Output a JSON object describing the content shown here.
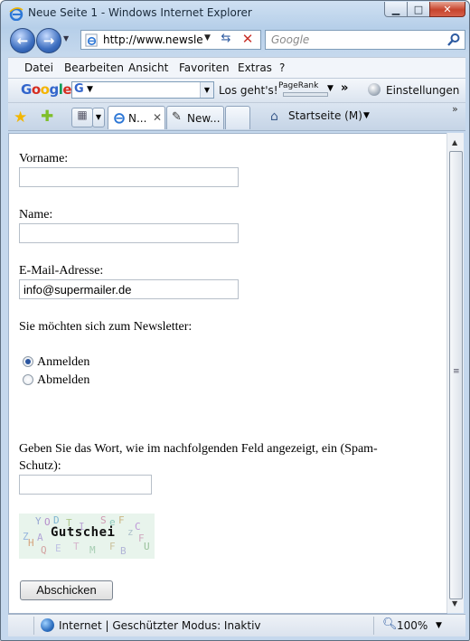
{
  "window": {
    "title": "Neue Seite 1 - Windows Internet Explorer",
    "minimize": "▁",
    "maximize": "□",
    "close": "✕"
  },
  "nav": {
    "address": "http://www.newsle",
    "search_placeholder": "Google"
  },
  "menu": [
    "Datei",
    "Bearbeiten",
    "Ansicht",
    "Favoriten",
    "Extras",
    "?"
  ],
  "google_toolbar": {
    "logo": "Google",
    "combo_letter": "G",
    "go": "Los geht's!",
    "pagerank": "PageRank",
    "more": "»",
    "settings": "Einstellungen"
  },
  "tabs": {
    "items": [
      {
        "label": "N...",
        "active": true
      },
      {
        "label": "New...",
        "active": false
      }
    ],
    "home": "Startseite (M)"
  },
  "form": {
    "vorname_label": "Vorname:",
    "vorname_value": "",
    "name_label": "Name:",
    "name_value": "",
    "email_label": "E-Mail-Adresse:",
    "email_value": "info@supermailer.de",
    "newsletter_question": "Sie möchten sich zum Newsletter:",
    "options": [
      {
        "label": "Anmelden",
        "checked": true
      },
      {
        "label": "Abmelden",
        "checked": false
      }
    ],
    "captcha_prompt_line1": "Geben Sie das Wort, wie im nachfolgenden Feld angezeigt, ein (Spam-",
    "captcha_prompt_line2": "Schutz):",
    "captcha_value": "",
    "captcha_word": "Gutschei",
    "submit": "Abschicken"
  },
  "status": {
    "text": "Internet | Geschützter Modus: Inaktiv",
    "zoom": "100%"
  },
  "colors": {
    "chrome": "#c5d8ed",
    "close_button": "#c7442d",
    "link_blue": "#2c5aa0"
  }
}
